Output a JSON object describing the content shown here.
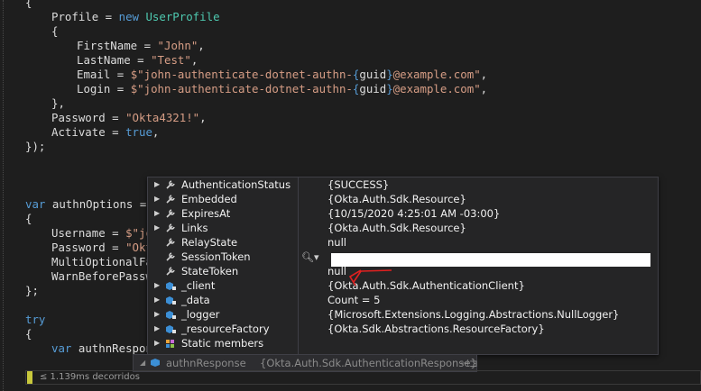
{
  "code": {
    "line1": "{",
    "line2_kw": "new",
    "line2_prop": "Profile",
    "line2_type": "UserProfile",
    "firstname_key": "FirstName",
    "firstname_val": "\"John\"",
    "lastname_key": "LastName",
    "lastname_val": "\"Test\"",
    "email_key": "Email",
    "email_str1": "$\"john-authenticate-dotnet-authn-",
    "email_str2": "@example.com\"",
    "login_key": "Login",
    "guid": "guid",
    "password_key": "Password",
    "password_val": "\"Okta4321!\"",
    "activate_key": "Activate",
    "activate_val": "true",
    "var_kw": "var",
    "authn_options": "authnOptions",
    "username_key": "Username",
    "username_val": "$\"joh",
    "password2_val": "\"Okta",
    "multi_factor": "MultiOptionalFac",
    "warn_before": "WarnBeforePasswo",
    "try_kw": "try",
    "authn_response": "authnRespons"
  },
  "datatip": {
    "rows": [
      {
        "name": "AuthenticationStatus",
        "value": "{SUCCESS}",
        "icon": "wrench-icon"
      },
      {
        "name": "Embedded",
        "value": "{Okta.Auth.Sdk.Resource}",
        "icon": "wrench-icon"
      },
      {
        "name": "ExpiresAt",
        "value": "{10/15/2020 4:25:01 AM -03:00}",
        "icon": "wrench-icon"
      },
      {
        "name": "Links",
        "value": "{Okta.Auth.Sdk.Resource}",
        "icon": "wrench-icon"
      },
      {
        "name": "RelayState",
        "value": "null",
        "icon": "wrench-icon"
      },
      {
        "name": "SessionToken",
        "value": "",
        "icon": "wrench-icon"
      },
      {
        "name": "StateToken",
        "value": "null",
        "icon": "wrench-icon"
      },
      {
        "name": "_client",
        "value": "{Okta.Auth.Sdk.AuthenticationClient}",
        "icon": "private-field-icon"
      },
      {
        "name": "_data",
        "value": "Count = 5",
        "icon": "private-field-icon"
      },
      {
        "name": "_logger",
        "value": "{Microsoft.Extensions.Logging.Abstractions.NullLogger}",
        "icon": "private-field-icon"
      },
      {
        "name": "_resourceFactory",
        "value": "{Okta.Sdk.Abstractions.ResourceFactory}",
        "icon": "private-field-icon"
      },
      {
        "name": "Static members",
        "value": "",
        "icon": "static-members-icon"
      }
    ]
  },
  "subtip": {
    "name": "authnResponse",
    "value": "{Okta.Auth.Sdk.AuthenticationResponse}",
    "pin_glyph": "⊣⊐"
  },
  "status": {
    "elapsed": "≤ 1.139ms decorridos"
  },
  "colors": {
    "keyword": "#569cd6",
    "type": "#4ec9b0",
    "string": "#d69d85",
    "annotation": "#e02020"
  }
}
